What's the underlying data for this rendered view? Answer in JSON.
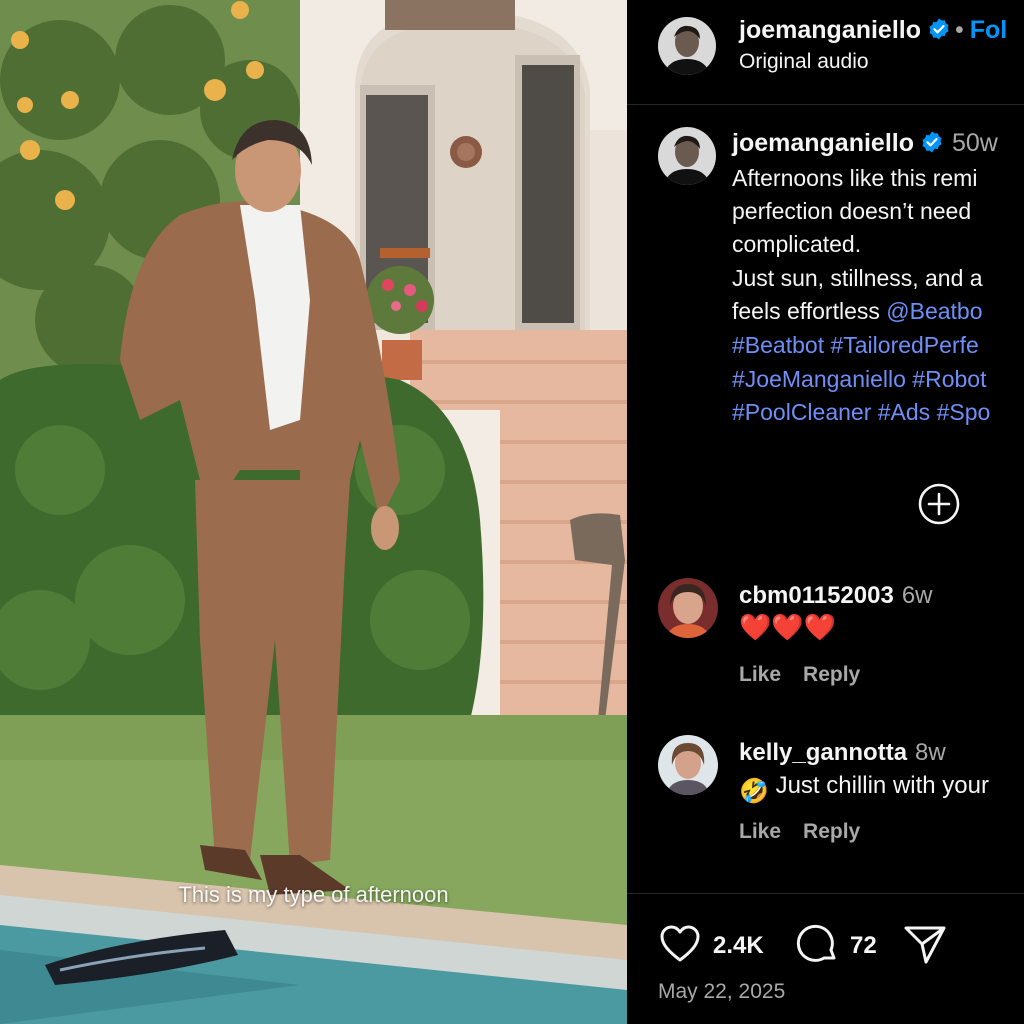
{
  "video": {
    "caption": "This is my type of afternoon"
  },
  "header": {
    "username": "joemanganiello",
    "separator": "•",
    "follow_label": "Fol",
    "audio_label": "Original audio"
  },
  "post_caption": {
    "username": "joemanganiello",
    "time": "50w",
    "lines": [
      "Afternoons like this remi",
      "perfection doesn’t need",
      "complicated.",
      "Just sun, stillness, and a",
      "feels effortless "
    ],
    "mention": "@Beatbo",
    "hashtag_lines": [
      "#Beatbot #TailoredPerfe",
      "#JoeManganiello #Robot",
      "#PoolCleaner #Ads #Spo"
    ]
  },
  "comments": [
    {
      "username": "cbm01152003",
      "time": "6w",
      "text": "❤️❤️❤️",
      "like_label": "Like",
      "reply_label": "Reply"
    },
    {
      "username": "kelly_gannotta",
      "time": "8w",
      "emoji": "🤣",
      "text": "Just chillin with your",
      "like_label": "Like",
      "reply_label": "Reply"
    }
  ],
  "actions": {
    "likes": "2.4K",
    "comments": "72"
  },
  "post_date": "May 22, 2025",
  "colors": {
    "panel_bg": "#000000",
    "link_blue": "#0095f6",
    "hashtag_blue": "#6f8ff7",
    "muted_text": "#a8a8a8",
    "verified_blue": "#0095f6",
    "heart_red": "#e0245e"
  },
  "icons": [
    "verified-badge-icon",
    "add-circle-icon",
    "heart-icon",
    "comment-icon",
    "share-icon"
  ]
}
